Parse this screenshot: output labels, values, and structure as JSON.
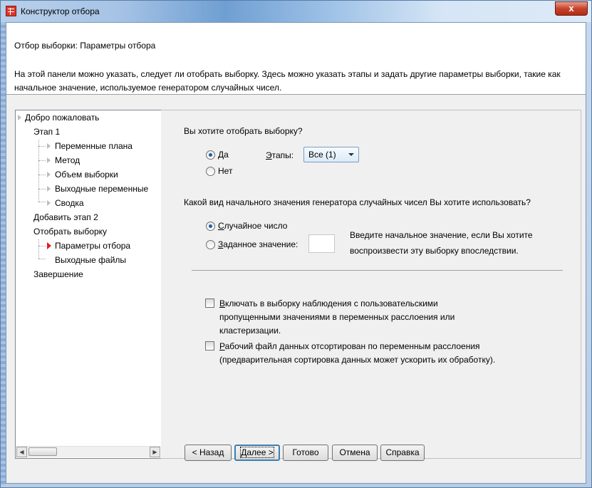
{
  "window": {
    "title": "Конструктор отбора",
    "close_label": "x"
  },
  "header": {
    "title": "Отбор выборки: Параметры отбора",
    "description": "На этой панели можно указать, следует ли отобрать выборку. Здесь можно указать этапы и задать другие параметры выборки, такие как начальное значение, используемое генератором случайных чисел."
  },
  "nav": {
    "items": [
      {
        "label": "Добро пожаловать"
      },
      {
        "label": "Этап 1"
      },
      {
        "label": "Переменные плана"
      },
      {
        "label": "Метод"
      },
      {
        "label": "Объем выборки"
      },
      {
        "label": "Выходные переменные"
      },
      {
        "label": "Сводка"
      },
      {
        "label": "Добавить этап 2"
      },
      {
        "label": "Отобрать выборку"
      },
      {
        "label": "Параметры отбора"
      },
      {
        "label": "Выходные файлы"
      },
      {
        "label": "Завершение"
      }
    ],
    "active": "Параметры отбора"
  },
  "panel": {
    "question_sample": "Вы хотите отобрать выборку?",
    "yes": {
      "prefix": "",
      "accel": "Д",
      "rest": "а",
      "checked": true
    },
    "no": {
      "label": "Нет",
      "checked": false
    },
    "stages": {
      "accel": "Э",
      "rest": "тапы:",
      "value": "Все (1)"
    },
    "question_seed": "Какой вид начального значения генератора случайных чисел Вы хотите использовать?",
    "random": {
      "accel": "С",
      "rest": "лучайное число",
      "checked": true
    },
    "fixed": {
      "accel": "З",
      "rest": "аданное значение:",
      "checked": false,
      "value": ""
    },
    "seed_hint_1": "Введите начальное значение, если Вы хотите",
    "seed_hint_2": "воспроизвести эту выборку впоследствии.",
    "include_missing": {
      "accel": "В",
      "rest": "ключать в выборку наблюдения с пользовательскими",
      "line2": "пропущенными значениями в переменных расслоения или",
      "line3": "кластеризации.",
      "checked": false
    },
    "sorted": {
      "accel": "Р",
      "rest": "абочий файл данных отсортирован по переменным расслоения",
      "line2": "(предварительная сортировка данных может ускорить их обработку).",
      "checked": false
    }
  },
  "buttons": {
    "back": "< Назад",
    "next": "Далее >",
    "finish": "Готово",
    "cancel": "Отмена",
    "help": "Справка"
  },
  "colors": {
    "accent": "#1e5ea8",
    "active_marker": "#e02020",
    "close": "#c7432b"
  }
}
